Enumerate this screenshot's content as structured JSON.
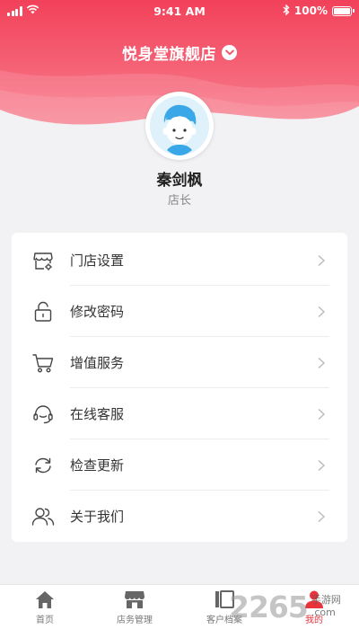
{
  "status_bar": {
    "time": "9:41 AM",
    "battery": "100%"
  },
  "header": {
    "store_name": "悦身堂旗舰店"
  },
  "profile": {
    "name": "秦剑枫",
    "role": "店长"
  },
  "menu": {
    "items": [
      {
        "label": "门店设置",
        "icon": "store-settings-icon"
      },
      {
        "label": "修改密码",
        "icon": "lock-icon"
      },
      {
        "label": "增值服务",
        "icon": "cart-icon"
      },
      {
        "label": "在线客服",
        "icon": "headset-icon"
      },
      {
        "label": "检查更新",
        "icon": "refresh-icon"
      },
      {
        "label": "关于我们",
        "icon": "users-icon"
      }
    ]
  },
  "tabbar": {
    "tabs": [
      {
        "label": "首页",
        "icon": "home-icon",
        "active": false
      },
      {
        "label": "店务管理",
        "icon": "shop-icon",
        "active": false
      },
      {
        "label": "客户档案",
        "icon": "profile-card-icon",
        "active": false
      },
      {
        "label": "我的",
        "icon": "user-icon",
        "active": true
      }
    ]
  },
  "watermark": {
    "number": "2265",
    "line1": "手游网",
    "line2": ".com"
  },
  "colors": {
    "accent": "#e8323c",
    "header_top": "#f24a5b",
    "header_bottom": "#f7768a"
  }
}
